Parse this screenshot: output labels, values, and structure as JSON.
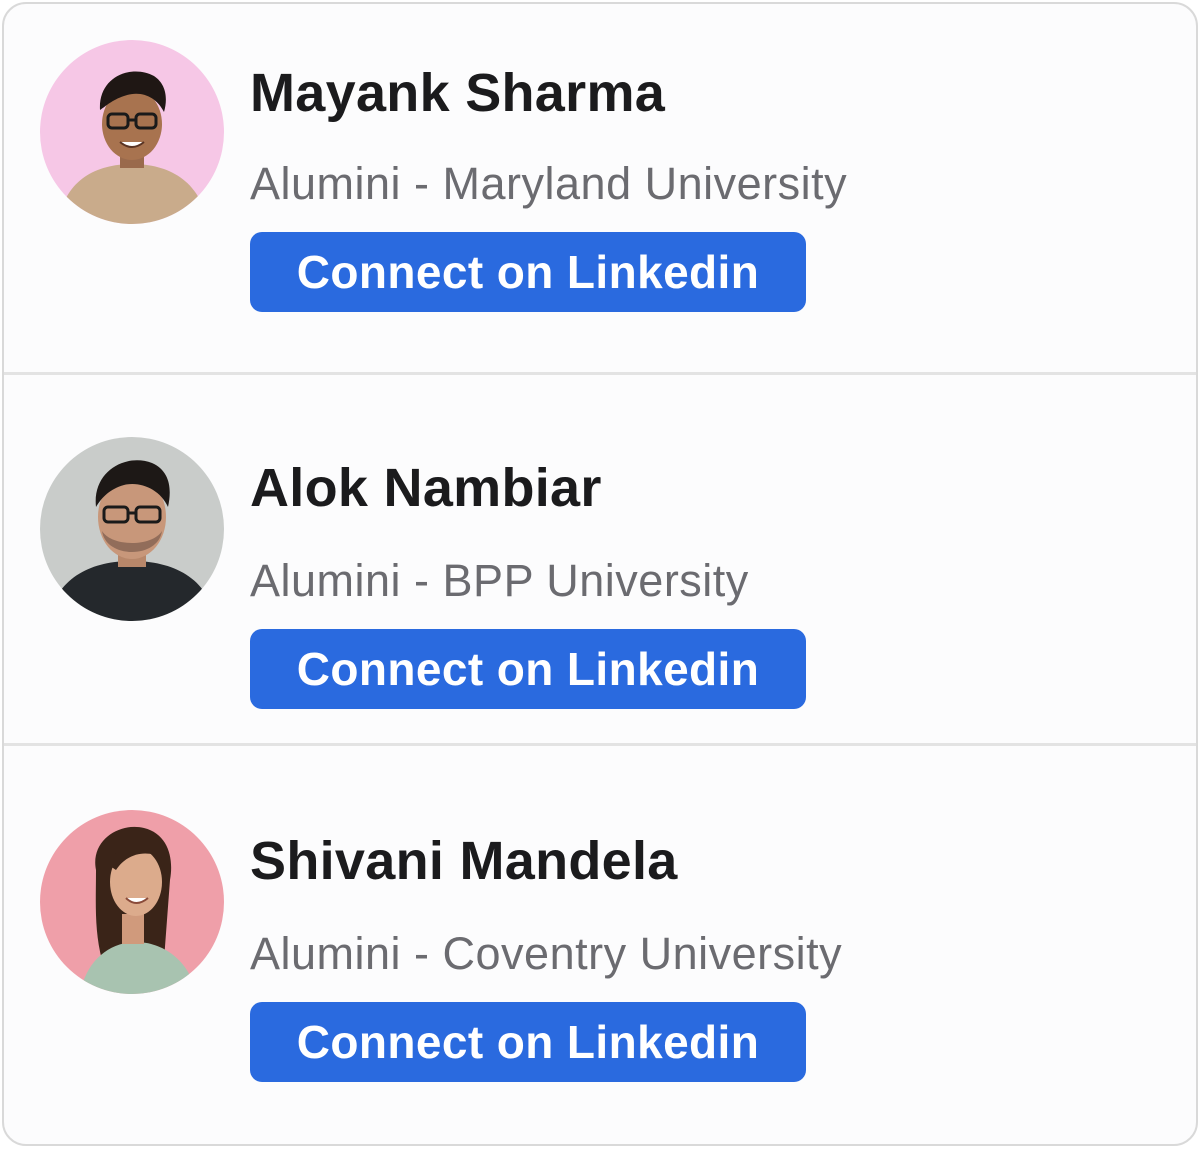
{
  "alumni": [
    {
      "name": "Mayank Sharma",
      "subtitle": "Alumini - Maryland University",
      "button_label": "Connect on Linkedin",
      "avatar_bg": "#f6c7e6"
    },
    {
      "name": "Alok Nambiar",
      "subtitle": "Alumini - BPP University",
      "button_label": "Connect on Linkedin",
      "avatar_bg": "#c9ccca"
    },
    {
      "name": "Shivani Mandela",
      "subtitle": "Alumini - Coventry University",
      "button_label": "Connect on Linkedin",
      "avatar_bg": "#ef9fa9"
    }
  ],
  "colors": {
    "button": "#2a6adf",
    "name_text": "#1b1b1d",
    "subtitle_text": "#6b6b70"
  }
}
